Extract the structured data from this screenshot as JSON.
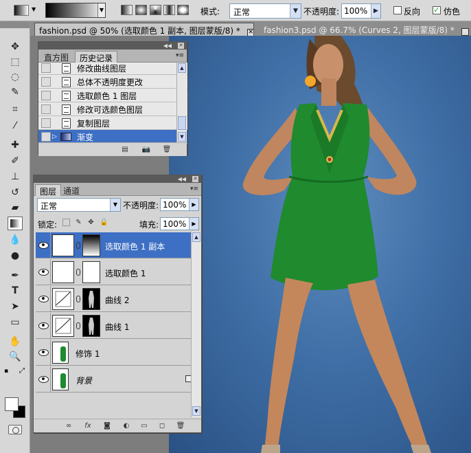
{
  "options_bar": {
    "mode_label": "模式:",
    "mode_value": "正常",
    "opacity_label": "不透明度:",
    "opacity_value": "100%",
    "reverse_label": "反向",
    "dither_label": "仿色",
    "reverse_checked": false,
    "dither_checked": true
  },
  "tabs": [
    {
      "label": "fashion.psd @ 50% (选取颜色 1 副本, 图层蒙版/8) *",
      "active": true
    },
    {
      "label": "fashion3.psd @ 66.7% (Curves 2, 图层蒙版/8) *",
      "active": false
    }
  ],
  "history_panel": {
    "tabs": [
      "直方图",
      "历史记录"
    ],
    "active_tab": "历史记录",
    "items": [
      {
        "label": "修改曲线图层",
        "selected": false
      },
      {
        "label": "总体不透明度更改",
        "selected": false
      },
      {
        "label": "选取颜色 1 图层",
        "selected": false
      },
      {
        "label": "修改可选颜色图层",
        "selected": false
      },
      {
        "label": "复制图层",
        "selected": false
      },
      {
        "label": "渐变",
        "selected": true
      }
    ]
  },
  "layers_panel": {
    "tabs": [
      "图层",
      "通道"
    ],
    "active_tab": "图层",
    "blend_mode": "正常",
    "opacity_label": "不透明度:",
    "opacity_value": "100%",
    "lock_label": "锁定:",
    "fill_label": "填充:",
    "fill_value": "100%",
    "layers": [
      {
        "name": "选取颜色 1 副本",
        "selected": true,
        "kind": "selective-color",
        "mask": "gradient"
      },
      {
        "name": "选取颜色 1",
        "selected": false,
        "kind": "selective-color",
        "mask": "white"
      },
      {
        "name": "曲线 2",
        "selected": false,
        "kind": "curves",
        "mask": "silhouette"
      },
      {
        "name": "曲线 1",
        "selected": false,
        "kind": "curves",
        "mask": "silhouette"
      },
      {
        "name": "修饰 1",
        "selected": false,
        "kind": "photo"
      },
      {
        "name": "背景",
        "selected": false,
        "kind": "photo",
        "locked": true
      }
    ]
  },
  "colors": {
    "selection": "#3d6fc4",
    "canvas_bg": "#3f6fa6",
    "dress": "#1f8a2e"
  }
}
